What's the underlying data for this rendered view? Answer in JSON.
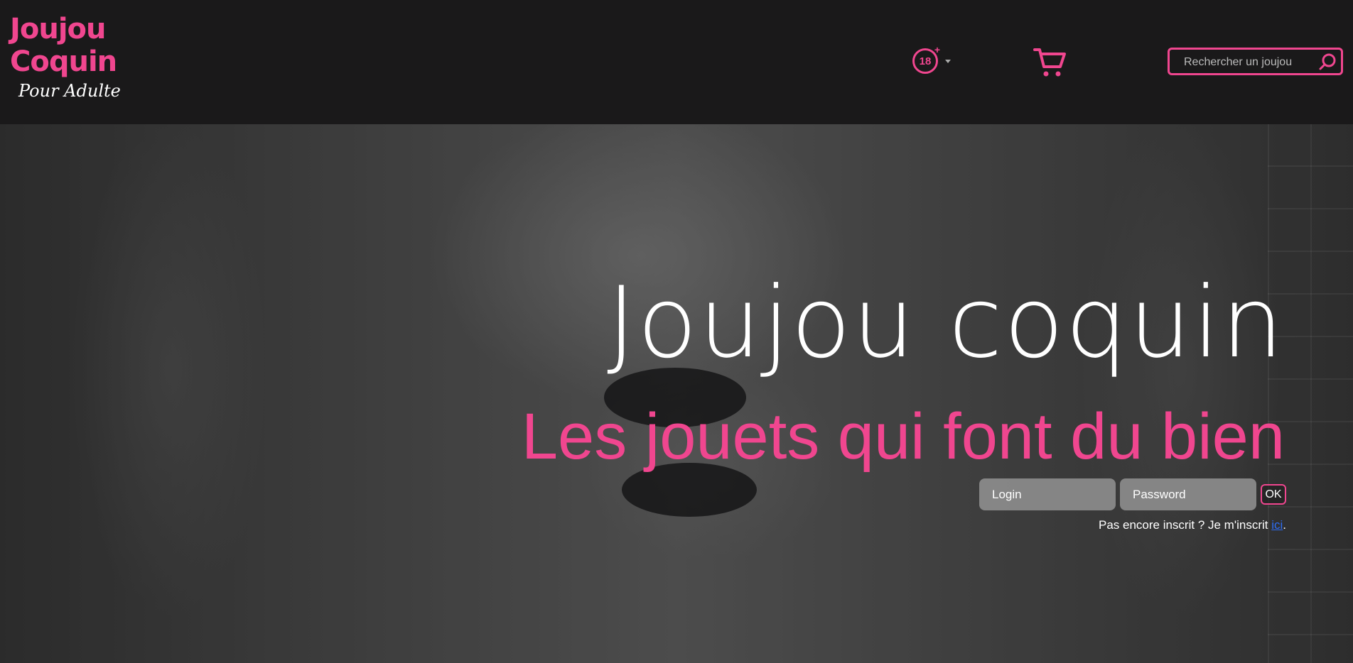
{
  "brand": {
    "logo_line1": "Joujou",
    "logo_line2": "Coquin",
    "logo_tagline": "Pour Adulte",
    "accent_color": "#f0468f"
  },
  "header": {
    "age_badge_label": "18",
    "age_badge_plus": "+",
    "age_icon": "age-18-plus-icon",
    "cart_icon": "shopping-cart-icon",
    "search_placeholder": "Rechercher un joujou",
    "search_icon": "search-icon"
  },
  "hero": {
    "title": "Joujou coquin",
    "subtitle": "Les jouets qui font du bien"
  },
  "login": {
    "login_placeholder": "Login",
    "password_placeholder": "Password",
    "ok_label": "OK",
    "signup_text": "Pas encore inscrit ? Je m'inscrit ",
    "signup_link": "ici",
    "signup_end": "."
  }
}
